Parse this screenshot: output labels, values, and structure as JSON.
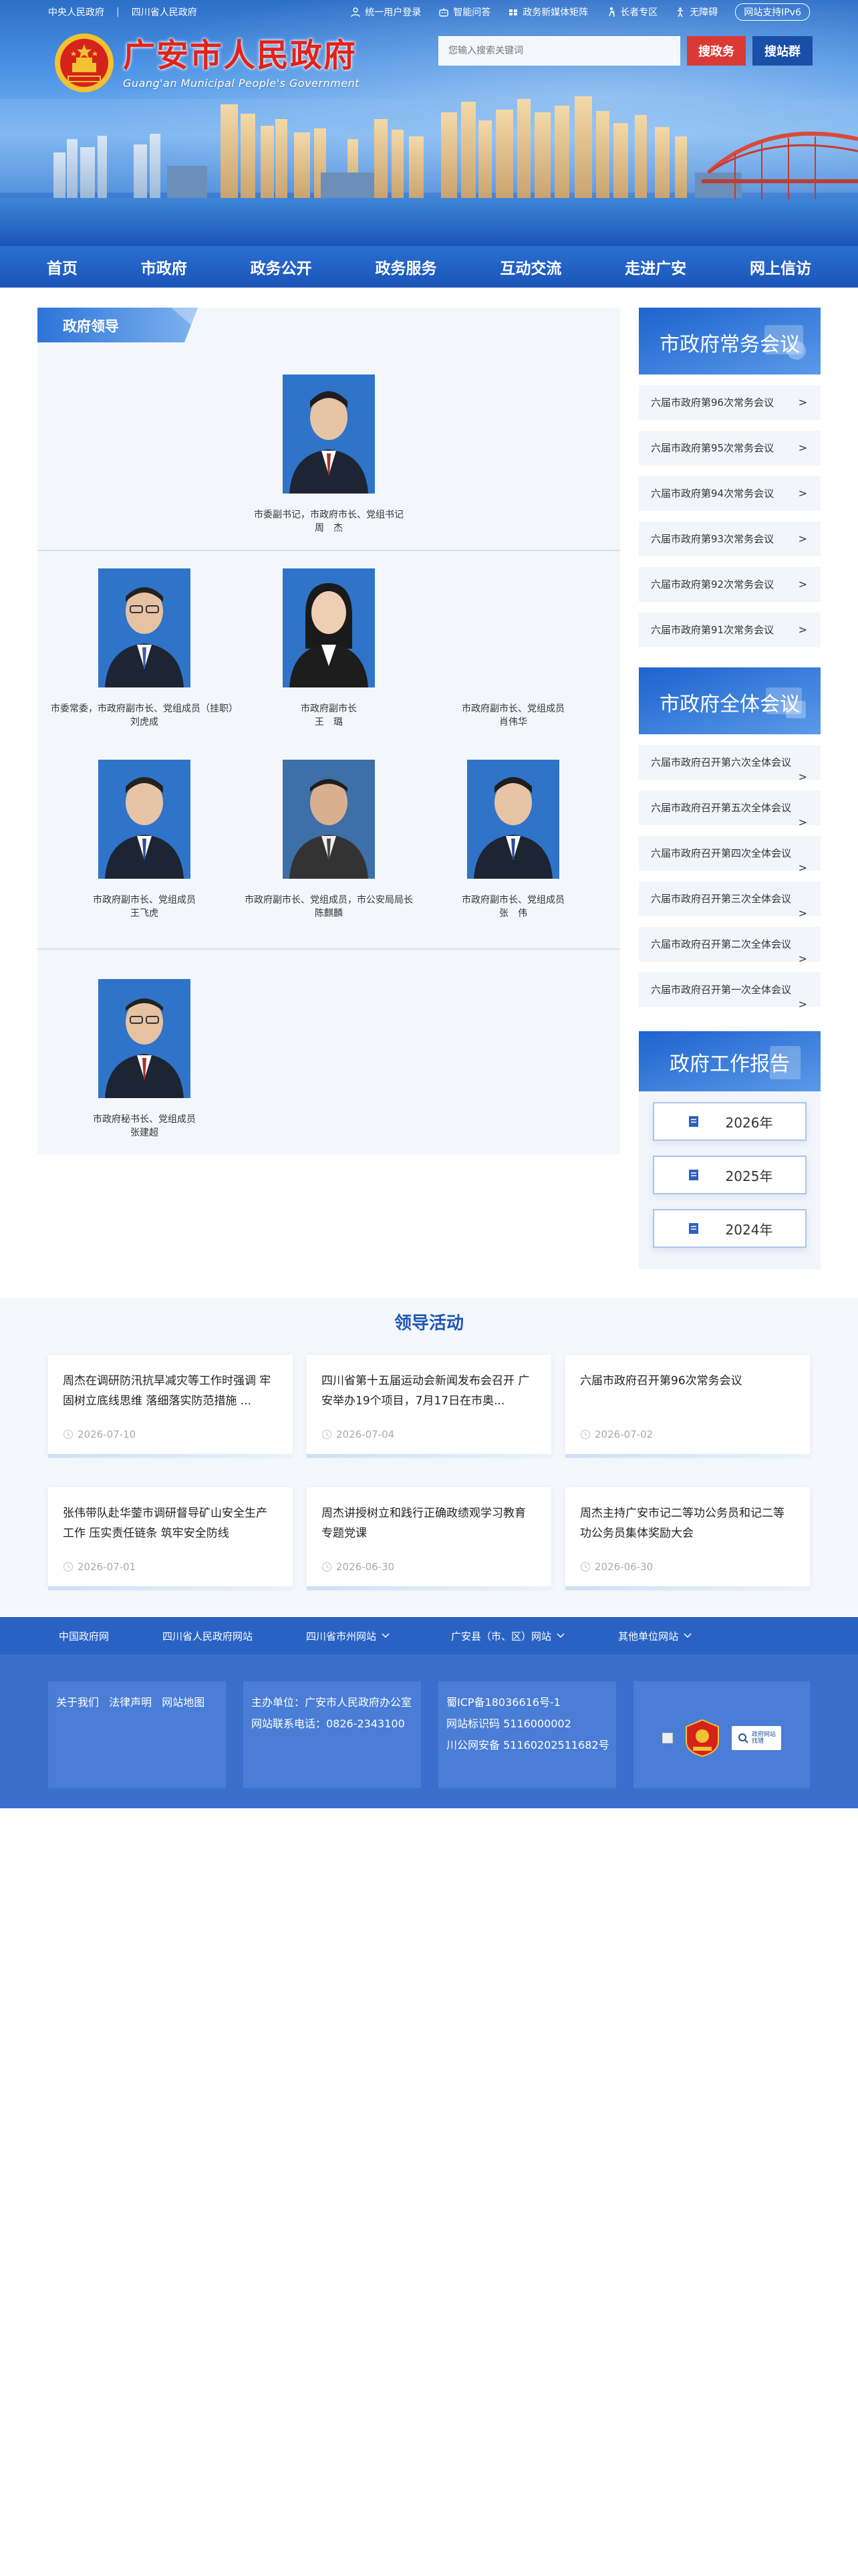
{
  "header": {
    "top_links": [
      "中央人民政府",
      "四川省人民政府"
    ],
    "separator": "|",
    "tools": [
      "统一用户登录",
      "智能问答",
      "政务新媒体矩阵",
      "长者专区",
      "无障碍"
    ],
    "ipv6": "网站支持IPv6",
    "site_title": "广安市人民政府",
    "site_subtitle": "Guang'an Municipal People's Government",
    "search_placeholder": "您输入搜索关键词",
    "search_gov": "搜政务",
    "search_group": "搜站群"
  },
  "nav": [
    "首页",
    "市政府",
    "政务公开",
    "政务服务",
    "互动交流",
    "走进广安",
    "网上信访"
  ],
  "leaders": {
    "panel_title": "政府领导",
    "people": [
      {
        "title": "市委副书记，市政府市长、党组书记",
        "name": "周　杰"
      },
      {
        "title": "市委常委，市政府副市长、党组成员（挂职）",
        "name": "刘虎成"
      },
      {
        "title": "市政府副市长",
        "name": "王　璐"
      },
      {
        "title": "市政府副市长、党组成员",
        "name": "肖伟华"
      },
      {
        "title": "市政府副市长、党组成员",
        "name": "王飞虎"
      },
      {
        "title": "市政府副市长、党组成员，市公安局局长",
        "name": "陈麒麟"
      },
      {
        "title": "市政府副市长、党组成员",
        "name": "张　伟"
      },
      {
        "title": "市政府秘书长、党组成员",
        "name": "张建超"
      }
    ]
  },
  "sidebar": {
    "standing_title": "市政府常务会议",
    "standing": [
      "六届市政府第96次常务会议",
      "六届市政府第95次常务会议",
      "六届市政府第94次常务会议",
      "六届市政府第93次常务会议",
      "六届市政府第92次常务会议",
      "六届市政府第91次常务会议"
    ],
    "plenary_title": "市政府全体会议",
    "plenary": [
      "六届市政府召开第六次全体会议",
      "六届市政府召开第五次全体会议",
      "六届市政府召开第四次全体会议",
      "六届市政府召开第三次全体会议",
      "六届市政府召开第二次全体会议",
      "六届市政府召开第一次全体会议"
    ],
    "report_title": "政府工作报告",
    "years": [
      "2026年",
      "2025年",
      "2024年"
    ],
    "arrow": ">"
  },
  "activities": {
    "title": "领导活动",
    "items": [
      {
        "title": "周杰在调研防汛抗旱减灾等工作时强调 牢固树立底线思维 落细落实防范措施 ...",
        "date": "2026-07-10"
      },
      {
        "title": "四川省第十五届运动会新闻发布会召开 广安举办19个项目，7月17日在市奥...",
        "date": "2026-07-04"
      },
      {
        "title": "六届市政府召开第96次常务会议",
        "date": "2026-07-02"
      },
      {
        "title": "张伟带队赴华蓥市调研督导矿山安全生产工作 压实责任链条 筑牢安全防线",
        "date": "2026-07-01"
      },
      {
        "title": "周杰讲授树立和践行正确政绩观学习教育专题党课",
        "date": "2026-06-30"
      },
      {
        "title": "周杰主持广安市记二等功公务员和记二等功公务员集体奖励大会",
        "date": "2026-06-30"
      }
    ]
  },
  "footer": {
    "links": [
      "中国政府网",
      "四川省人民政府网站",
      "四川省市州网站",
      "广安县（市、区）网站",
      "其他单位网站"
    ],
    "about": [
      "关于我们",
      "法律声明",
      "网站地图"
    ],
    "host": "主办单位：广安市人民政府办公室",
    "phone": "网站联系电话：0826-2343100",
    "icp": "蜀ICP备18036616号-1",
    "site_id": "网站标识码 5116000002",
    "police": "川公网安备 51160202511682号",
    "badge_text_1": "政府网站",
    "badge_text_2": "找错"
  }
}
